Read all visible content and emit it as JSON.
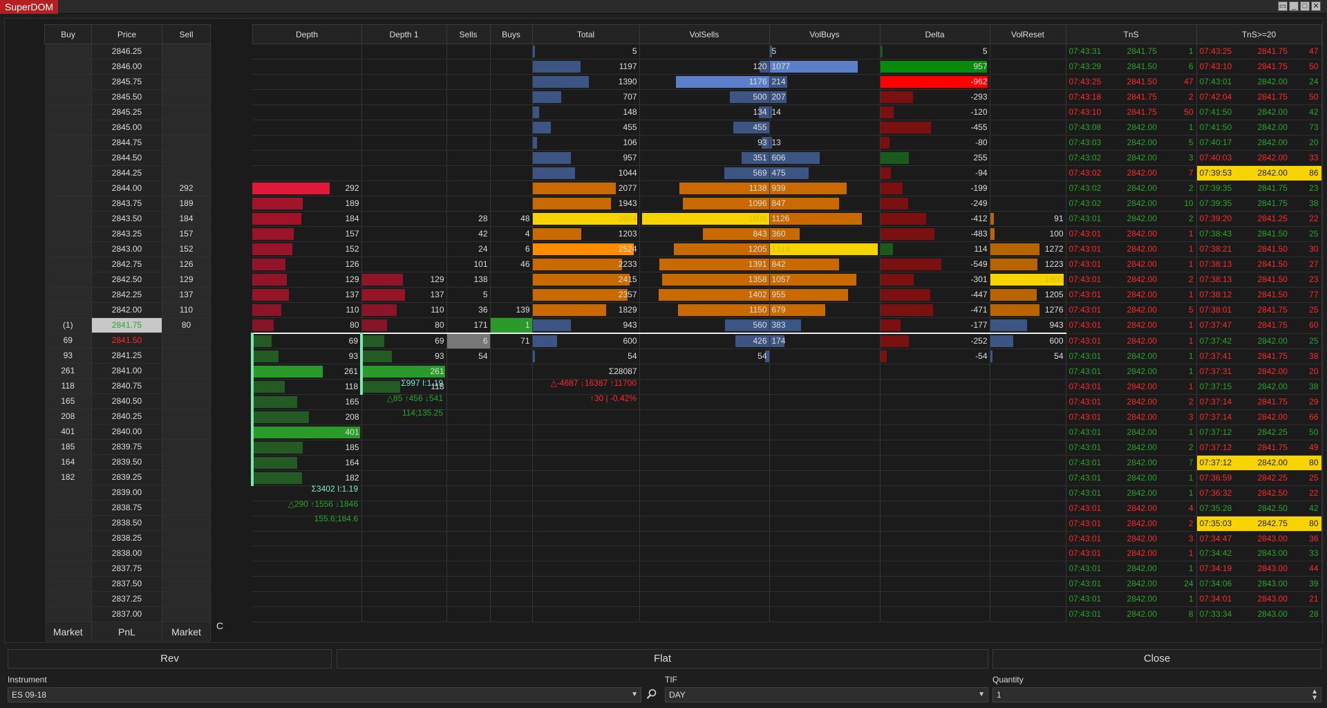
{
  "window": {
    "title": "SuperDOM"
  },
  "colors": {
    "green": "#2aa52a",
    "red": "#ff2a2a",
    "yellow": "#f7d400"
  },
  "ladder": {
    "headers": [
      "Buy",
      "Price",
      "Sell"
    ],
    "rows": [
      [
        "",
        "2846.25",
        ""
      ],
      [
        "",
        "2846.00",
        ""
      ],
      [
        "",
        "2845.75",
        ""
      ],
      [
        "",
        "2845.50",
        ""
      ],
      [
        "",
        "2845.25",
        ""
      ],
      [
        "",
        "2845.00",
        ""
      ],
      [
        "",
        "2844.75",
        ""
      ],
      [
        "",
        "2844.50",
        ""
      ],
      [
        "",
        "2844.25",
        ""
      ],
      [
        "",
        "2844.00",
        "292"
      ],
      [
        "",
        "2843.75",
        "189"
      ],
      [
        "",
        "2843.50",
        "184"
      ],
      [
        "",
        "2843.25",
        "157"
      ],
      [
        "",
        "2843.00",
        "152"
      ],
      [
        "",
        "2842.75",
        "126"
      ],
      [
        "",
        "2842.50",
        "129"
      ],
      [
        "",
        "2842.25",
        "137"
      ],
      [
        "",
        "2842.00",
        "110"
      ],
      [
        "(1)",
        "2841.75",
        "80"
      ],
      [
        "69",
        "2841.50",
        ""
      ],
      [
        "93",
        "2841.25",
        ""
      ],
      [
        "261",
        "2841.00",
        ""
      ],
      [
        "118",
        "2840.75",
        ""
      ],
      [
        "165",
        "2840.50",
        ""
      ],
      [
        "208",
        "2840.25",
        ""
      ],
      [
        "401",
        "2840.00",
        ""
      ],
      [
        "185",
        "2839.75",
        ""
      ],
      [
        "164",
        "2839.50",
        ""
      ],
      [
        "182",
        "2839.25",
        ""
      ],
      [
        "",
        "2839.00",
        ""
      ],
      [
        "",
        "2838.75",
        ""
      ],
      [
        "",
        "2838.50",
        ""
      ],
      [
        "",
        "2838.25",
        ""
      ],
      [
        "",
        "2838.00",
        ""
      ],
      [
        "",
        "2837.75",
        ""
      ],
      [
        "",
        "2837.50",
        ""
      ],
      [
        "",
        "2837.25",
        ""
      ],
      [
        "",
        "2837.00",
        ""
      ]
    ],
    "footer": [
      "Market",
      "PnL",
      "Market"
    ],
    "c_label": "C"
  },
  "columns": [
    "Depth",
    "Depth 1",
    "Sells",
    "Buys",
    "Total",
    "VolSells",
    "VolBuys",
    "Delta",
    "VolReset",
    "TnS",
    "TnS>=20"
  ],
  "depth": [
    "",
    "",
    "",
    "",
    "",
    "",
    "",
    "",
    "",
    "292",
    "189",
    "184",
    "157",
    "152",
    "126",
    "129",
    "137",
    "110",
    "80",
    "69",
    "93",
    "261",
    "118",
    "165",
    "208",
    "401",
    "185",
    "164",
    "182",
    "",
    "",
    "",
    "",
    "",
    "",
    "",
    "",
    ""
  ],
  "depth1": [
    "",
    "",
    "",
    "",
    "",
    "",
    "",
    "",
    "",
    "",
    "",
    "",
    "",
    "",
    "",
    "129",
    "137",
    "110",
    "80",
    "69",
    "93",
    "261",
    "118",
    "",
    "",
    "",
    "",
    "",
    "",
    "",
    "",
    "",
    "",
    "",
    "",
    "",
    "",
    ""
  ],
  "sells": [
    "",
    "",
    "",
    "",
    "",
    "",
    "",
    "",
    "",
    "",
    "",
    "28",
    "42",
    "24",
    "101",
    "138",
    "5",
    "36",
    "171",
    "6",
    "54",
    "",
    "",
    "",
    "",
    "",
    "",
    "",
    "",
    "",
    "",
    "",
    "",
    "",
    "",
    "",
    "",
    ""
  ],
  "buys": [
    "",
    "",
    "",
    "",
    "",
    "",
    "",
    "",
    "",
    "",
    "",
    "48",
    "4",
    "6",
    "46",
    "",
    "",
    "139",
    "1",
    "71",
    "",
    "",
    "",
    "",
    "",
    "",
    "",
    "",
    "",
    "",
    "",
    "",
    "",
    "",
    "",
    "",
    "",
    ""
  ],
  "total": [
    "5",
    "1197",
    "1390",
    "707",
    "148",
    "455",
    "106",
    "957",
    "1044",
    "2077",
    "1943",
    "2604",
    "1203",
    "2524",
    "2233",
    "2415",
    "2357",
    "1829",
    "943",
    "600",
    "54",
    "Σ28087",
    "",
    "",
    "",
    "",
    "",
    "",
    "",
    "",
    "",
    "",
    "",
    "",
    "",
    "",
    "",
    ""
  ],
  "volsells": [
    "",
    "120",
    "1176",
    "500",
    "134",
    "455",
    "93",
    "351",
    "569",
    "1138",
    "1096",
    "1608",
    "843",
    "1205",
    "1391",
    "1358",
    "1402",
    "1150",
    "560",
    "426",
    "54",
    "",
    "",
    "",
    "",
    "",
    "",
    "",
    "",
    "",
    "",
    "",
    "",
    "",
    "",
    "",
    "",
    ""
  ],
  "volbuys": [
    "5",
    "1077",
    "214",
    "207",
    "14",
    "",
    "13",
    "606",
    "475",
    "939",
    "847",
    "1126",
    "360",
    "1319",
    "842",
    "1057",
    "955",
    "679",
    "383",
    "174",
    "",
    "",
    "",
    "",
    "",
    "",
    "",
    "",
    "",
    "",
    "",
    "",
    "",
    "",
    "",
    "",
    "",
    ""
  ],
  "delta": [
    "5",
    "957",
    "-962",
    "-293",
    "-120",
    "-455",
    "-80",
    "255",
    "-94",
    "-199",
    "-249",
    "-412",
    "-483",
    "114",
    "-549",
    "-301",
    "-447",
    "-471",
    "-177",
    "-252",
    "-54",
    "",
    "",
    "",
    "",
    "",
    "",
    "",
    "",
    "",
    "",
    "",
    "",
    "",
    "",
    "",
    "",
    ""
  ],
  "volreset": [
    "",
    "",
    "",
    "",
    "",
    "",
    "",
    "",
    "",
    "",
    "",
    "91",
    "100",
    "1272",
    "1223",
    "1900",
    "1205",
    "1276",
    "943",
    "600",
    "54",
    "",
    "",
    "",
    "",
    "",
    "",
    "",
    "",
    "",
    "",
    "",
    "",
    "",
    "",
    "",
    "",
    ""
  ],
  "tns": [
    [
      "07:43:31",
      "2841.75",
      "1"
    ],
    [
      "07:43:29",
      "2841.50",
      "6"
    ],
    [
      "07:43:25",
      "2841.50",
      "47"
    ],
    [
      "07:43:18",
      "2841.75",
      "2"
    ],
    [
      "07:43:10",
      "2841.75",
      "50"
    ],
    [
      "07:43:08",
      "2842.00",
      "1"
    ],
    [
      "07:43:03",
      "2842.00",
      "5"
    ],
    [
      "07:43:02",
      "2842.00",
      "3"
    ],
    [
      "07:43:02",
      "2842.00",
      "7"
    ],
    [
      "07:43:02",
      "2842.00",
      "2"
    ],
    [
      "07:43:02",
      "2842.00",
      "10"
    ],
    [
      "07:43:01",
      "2842.00",
      "2"
    ],
    [
      "07:43:01",
      "2842.00",
      "1"
    ],
    [
      "07:43:01",
      "2842.00",
      "1"
    ],
    [
      "07:43:01",
      "2842.00",
      "1"
    ],
    [
      "07:43:01",
      "2842.00",
      "2"
    ],
    [
      "07:43:01",
      "2842.00",
      "1"
    ],
    [
      "07:43:01",
      "2842.00",
      "5"
    ],
    [
      "07:43:01",
      "2842.00",
      "1"
    ],
    [
      "07:43:01",
      "2842.00",
      "1"
    ],
    [
      "07:43:01",
      "2842.00",
      "1"
    ],
    [
      "07:43:01",
      "2842.00",
      "1"
    ],
    [
      "07:43:01",
      "2842.00",
      "1"
    ],
    [
      "07:43:01",
      "2842.00",
      "2"
    ],
    [
      "07:43:01",
      "2842.00",
      "3"
    ],
    [
      "07:43:01",
      "2842.00",
      "1"
    ],
    [
      "07:43:01",
      "2842.00",
      "2"
    ],
    [
      "07:43:01",
      "2842.00",
      "7"
    ],
    [
      "07:43:01",
      "2842.00",
      "1"
    ],
    [
      "07:43:01",
      "2842.00",
      "1"
    ],
    [
      "07:43:01",
      "2842.00",
      "4"
    ],
    [
      "07:43:01",
      "2842.00",
      "2"
    ],
    [
      "07:43:01",
      "2842.00",
      "3"
    ],
    [
      "07:43:01",
      "2842.00",
      "1"
    ],
    [
      "07:43:01",
      "2842.00",
      "1"
    ],
    [
      "07:43:01",
      "2842.00",
      "24"
    ],
    [
      "07:43:01",
      "2842.00",
      "1"
    ],
    [
      "07:43:01",
      "2842.00",
      "8"
    ]
  ],
  "tns_colors": [
    "g",
    "g",
    "r",
    "r",
    "r",
    "g",
    "g",
    "g",
    "r",
    "g",
    "g",
    "g",
    "r",
    "r",
    "r",
    "r",
    "r",
    "r",
    "r",
    "r",
    "g",
    "g",
    "r",
    "r",
    "r",
    "g",
    "g",
    "g",
    "g",
    "g",
    "r",
    "r",
    "r",
    "r",
    "g",
    "g",
    "g",
    "g"
  ],
  "tns20": [
    [
      "07:43:25",
      "2841.75",
      "47"
    ],
    [
      "07:43:10",
      "2841.75",
      "50"
    ],
    [
      "07:43:01",
      "2842.00",
      "24"
    ],
    [
      "07:42:04",
      "2841.75",
      "50"
    ],
    [
      "07:41:50",
      "2842.00",
      "42"
    ],
    [
      "07:41:50",
      "2842.00",
      "73"
    ],
    [
      "07:40:17",
      "2842.00",
      "20"
    ],
    [
      "07:40:03",
      "2842.00",
      "33"
    ],
    [
      "07:39:53",
      "2842.00",
      "86"
    ],
    [
      "07:39:35",
      "2841.75",
      "23"
    ],
    [
      "07:39:35",
      "2841.75",
      "38"
    ],
    [
      "07:39:20",
      "2841.25",
      "22"
    ],
    [
      "07:38:43",
      "2841.50",
      "25"
    ],
    [
      "07:38:21",
      "2841.50",
      "30"
    ],
    [
      "07:38:13",
      "2841.50",
      "27"
    ],
    [
      "07:38:13",
      "2841.50",
      "23"
    ],
    [
      "07:38:12",
      "2841.50",
      "77"
    ],
    [
      "07:38:01",
      "2841.75",
      "25"
    ],
    [
      "07:37:47",
      "2841.75",
      "60"
    ],
    [
      "07:37:42",
      "2842.00",
      "25"
    ],
    [
      "07:37:41",
      "2841.75",
      "38"
    ],
    [
      "07:37:31",
      "2842.00",
      "20"
    ],
    [
      "07:37:15",
      "2842.00",
      "38"
    ],
    [
      "07:37:14",
      "2841.75",
      "29"
    ],
    [
      "07:37:14",
      "2842.00",
      "66"
    ],
    [
      "07:37:12",
      "2842.25",
      "50"
    ],
    [
      "07:37:12",
      "2841.75",
      "49"
    ],
    [
      "07:37:12",
      "2842.00",
      "80"
    ],
    [
      "07:36:59",
      "2842.25",
      "25"
    ],
    [
      "07:36:32",
      "2842.50",
      "22"
    ],
    [
      "07:35:28",
      "2842.50",
      "42"
    ],
    [
      "07:35:03",
      "2842.75",
      "80"
    ],
    [
      "07:34:47",
      "2843.00",
      "36"
    ],
    [
      "07:34:42",
      "2843.00",
      "33"
    ],
    [
      "07:34:19",
      "2843.00",
      "44"
    ],
    [
      "07:34:06",
      "2843.00",
      "39"
    ],
    [
      "07:34:01",
      "2843.00",
      "21"
    ],
    [
      "07:33:34",
      "2843.00",
      "28"
    ]
  ],
  "tns20_colors": [
    "r",
    "r",
    "g",
    "r",
    "g",
    "g",
    "g",
    "r",
    "y",
    "g",
    "g",
    "r",
    "g",
    "r",
    "r",
    "r",
    "r",
    "r",
    "r",
    "g",
    "r",
    "r",
    "g",
    "r",
    "r",
    "g",
    "r",
    "y",
    "r",
    "r",
    "g",
    "y",
    "r",
    "g",
    "r",
    "g",
    "r",
    "g"
  ],
  "depth_stats": {
    "sum": "Σ3402 I:1.19",
    "flow": "△290 ↑1556 ↓1846",
    "avg": "155.6;184.6"
  },
  "depth1_stats": {
    "sum": "Σ997 I:1.19",
    "flow": "△85 ↑456 ↓541",
    "avg": "114;135.25"
  },
  "total_stats": {
    "flow": "△-4687 ↓16387 ↑11700",
    "pct": "↑30 | -0.42%"
  },
  "buttons": {
    "rev": "Rev",
    "flat": "Flat",
    "close": "Close"
  },
  "fields": {
    "instrument_label": "Instrument",
    "instrument_value": "ES 09-18",
    "tif_label": "TIF",
    "tif_value": "DAY",
    "quantity_label": "Quantity",
    "quantity_value": "1"
  }
}
